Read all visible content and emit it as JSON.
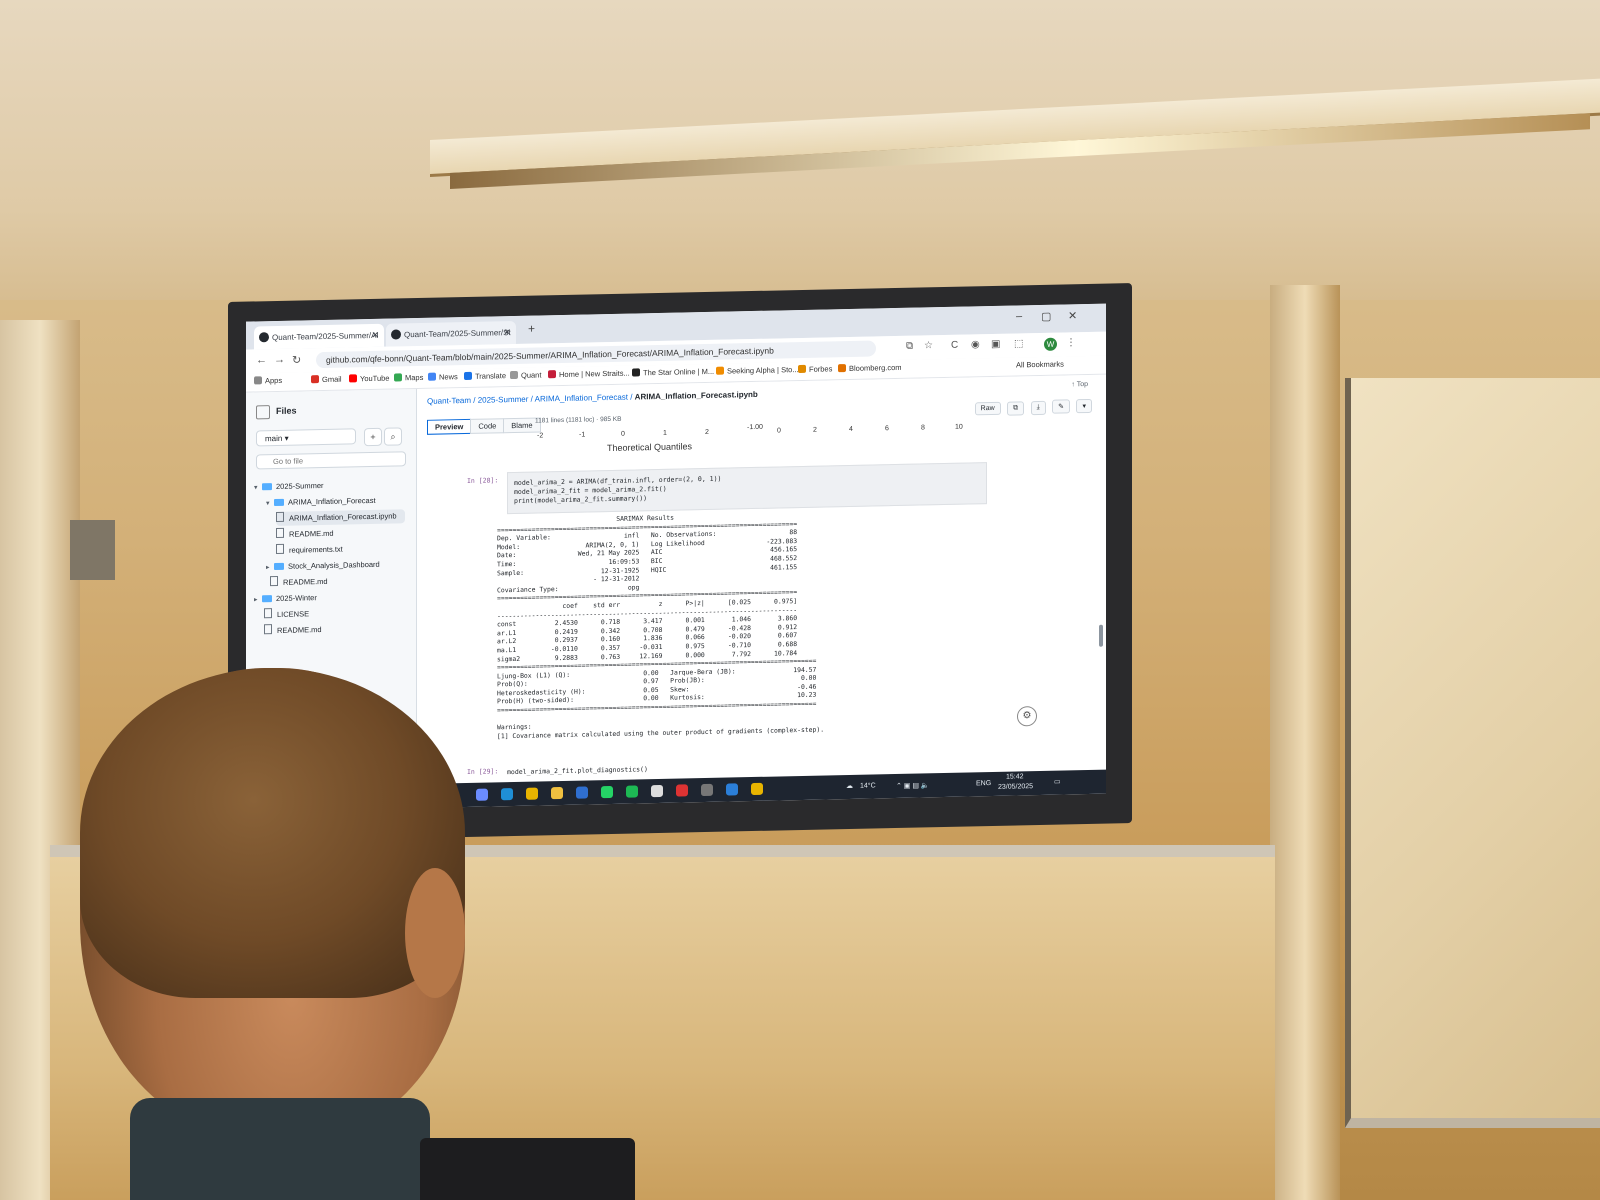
{
  "browser": {
    "tabs": [
      {
        "label": "Quant-Team/2025-Summer/AI",
        "active": true
      },
      {
        "label": "Quant-Team/2025-Summer/St",
        "active": false
      }
    ],
    "new_tab": "+",
    "window_controls": {
      "minimize": "–",
      "maximize": "▢",
      "close": "✕"
    },
    "url": "github.com/qfe-bonn/Quant-Team/blob/main/2025-Summer/ARIMA_Inflation_Forecast/ARIMA_Inflation_Forecast.ipynb",
    "bookmarks": [
      "Apps",
      "Gmail",
      "YouTube",
      "Maps",
      "News",
      "Translate",
      "Quant",
      "Home | New Straits...",
      "The Star Online | M...",
      "Seeking Alpha | Sto...",
      "Forbes",
      "Bloomberg.com"
    ],
    "all_bookmarks": "All Bookmarks",
    "profile_initial": "W"
  },
  "sidebar": {
    "title": "Files",
    "branch": "main",
    "go_to_file_placeholder": "Go to file",
    "tree": [
      {
        "label": "2025-Summer",
        "type": "folder",
        "depth": 0,
        "expanded": true
      },
      {
        "label": "ARIMA_Inflation_Forecast",
        "type": "folder",
        "depth": 1,
        "expanded": true
      },
      {
        "label": "ARIMA_Inflation_Forecast.ipynb",
        "type": "file",
        "depth": 2,
        "selected": true
      },
      {
        "label": "README.md",
        "type": "file",
        "depth": 2
      },
      {
        "label": "requirements.txt",
        "type": "file",
        "depth": 2
      },
      {
        "label": "Stock_Analysis_Dashboard",
        "type": "folder",
        "depth": 1,
        "expanded": false
      },
      {
        "label": "README.md",
        "type": "file",
        "depth": 1
      },
      {
        "label": "2025-Winter",
        "type": "folder",
        "depth": 0,
        "expanded": false
      },
      {
        "label": "LICENSE",
        "type": "file",
        "depth": 0
      },
      {
        "label": "README.md",
        "type": "file",
        "depth": 0
      }
    ]
  },
  "main": {
    "breadcrumb": {
      "root": "Quant-Team",
      "p1": "2025-Summer",
      "p2": "ARIMA_Inflation_Forecast",
      "file": "ARIMA_Inflation_Forecast.ipynb"
    },
    "top_link": "↑ Top",
    "view_tabs": [
      "Preview",
      "Code",
      "Blame"
    ],
    "file_info": "1181 lines (1181 loc) · 985 KB",
    "toolbar": {
      "raw": "Raw"
    },
    "plot_ticks_left": [
      "-2",
      "-1",
      "0",
      "1",
      "2"
    ],
    "plot_ticks_right": [
      "-1.00",
      "0",
      "2",
      "4",
      "6",
      "8",
      "10"
    ],
    "plot_axis_title": "Theoretical Quantiles",
    "cell_28_label": "In [28]:",
    "cell_28_code": "model_arima_2 = ARIMA(df_train.infl, order=(2, 0, 1))\nmodel_arima_2_fit = model_arima_2.fit()\nprint(model_arima_2_fit.summary())",
    "output": "                               SARIMAX Results                                \n==============================================================================\nDep. Variable:                   infl   No. Observations:                   88\nModel:                 ARIMA(2, 0, 1)   Log Likelihood                -223.083\nDate:                Wed, 21 May 2025   AIC                            456.165\nTime:                        16:09:53   BIC                            468.552\nSample:                    12-31-1925   HQIC                           461.155\n                         - 12-31-2012                                         \nCovariance Type:                  opg                                         \n==============================================================================\n                 coef    std err          z      P>|z|      [0.025      0.975]\n------------------------------------------------------------------------------\nconst          2.4530      0.718      3.417      0.001       1.046       3.860\nar.L1          0.2419      0.342      0.708      0.479      -0.428       0.912\nar.L2          0.2937      0.160      1.836      0.066      -0.020       0.607\nma.L1         -0.0110      0.357     -0.031      0.975      -0.710       0.688\nsigma2         9.2883      0.763     12.169      0.000       7.792      10.784\n===================================================================================\nLjung-Box (L1) (Q):                   0.00   Jarque-Bera (JB):               194.57\nProb(Q):                              0.97   Prob(JB):                         0.00\nHeteroskedasticity (H):               0.05   Skew:                            -0.46\nProb(H) (two-sided):                  0.00   Kurtosis:                        10.23\n===================================================================================\n\nWarnings:\n[1] Covariance matrix calculated using the outer product of gradients (complex-step).",
    "cell_29_label": "In [29]:",
    "cell_29_code": "model_arima_2_fit.plot_diagnostics()"
  },
  "taskbar": {
    "weather": "14°C",
    "language": "ENG",
    "time": "15:42",
    "date": "23/05/2025"
  },
  "colors": {
    "link": "#0969da",
    "folder": "#54aeff",
    "taskbar": "#1e2530"
  }
}
